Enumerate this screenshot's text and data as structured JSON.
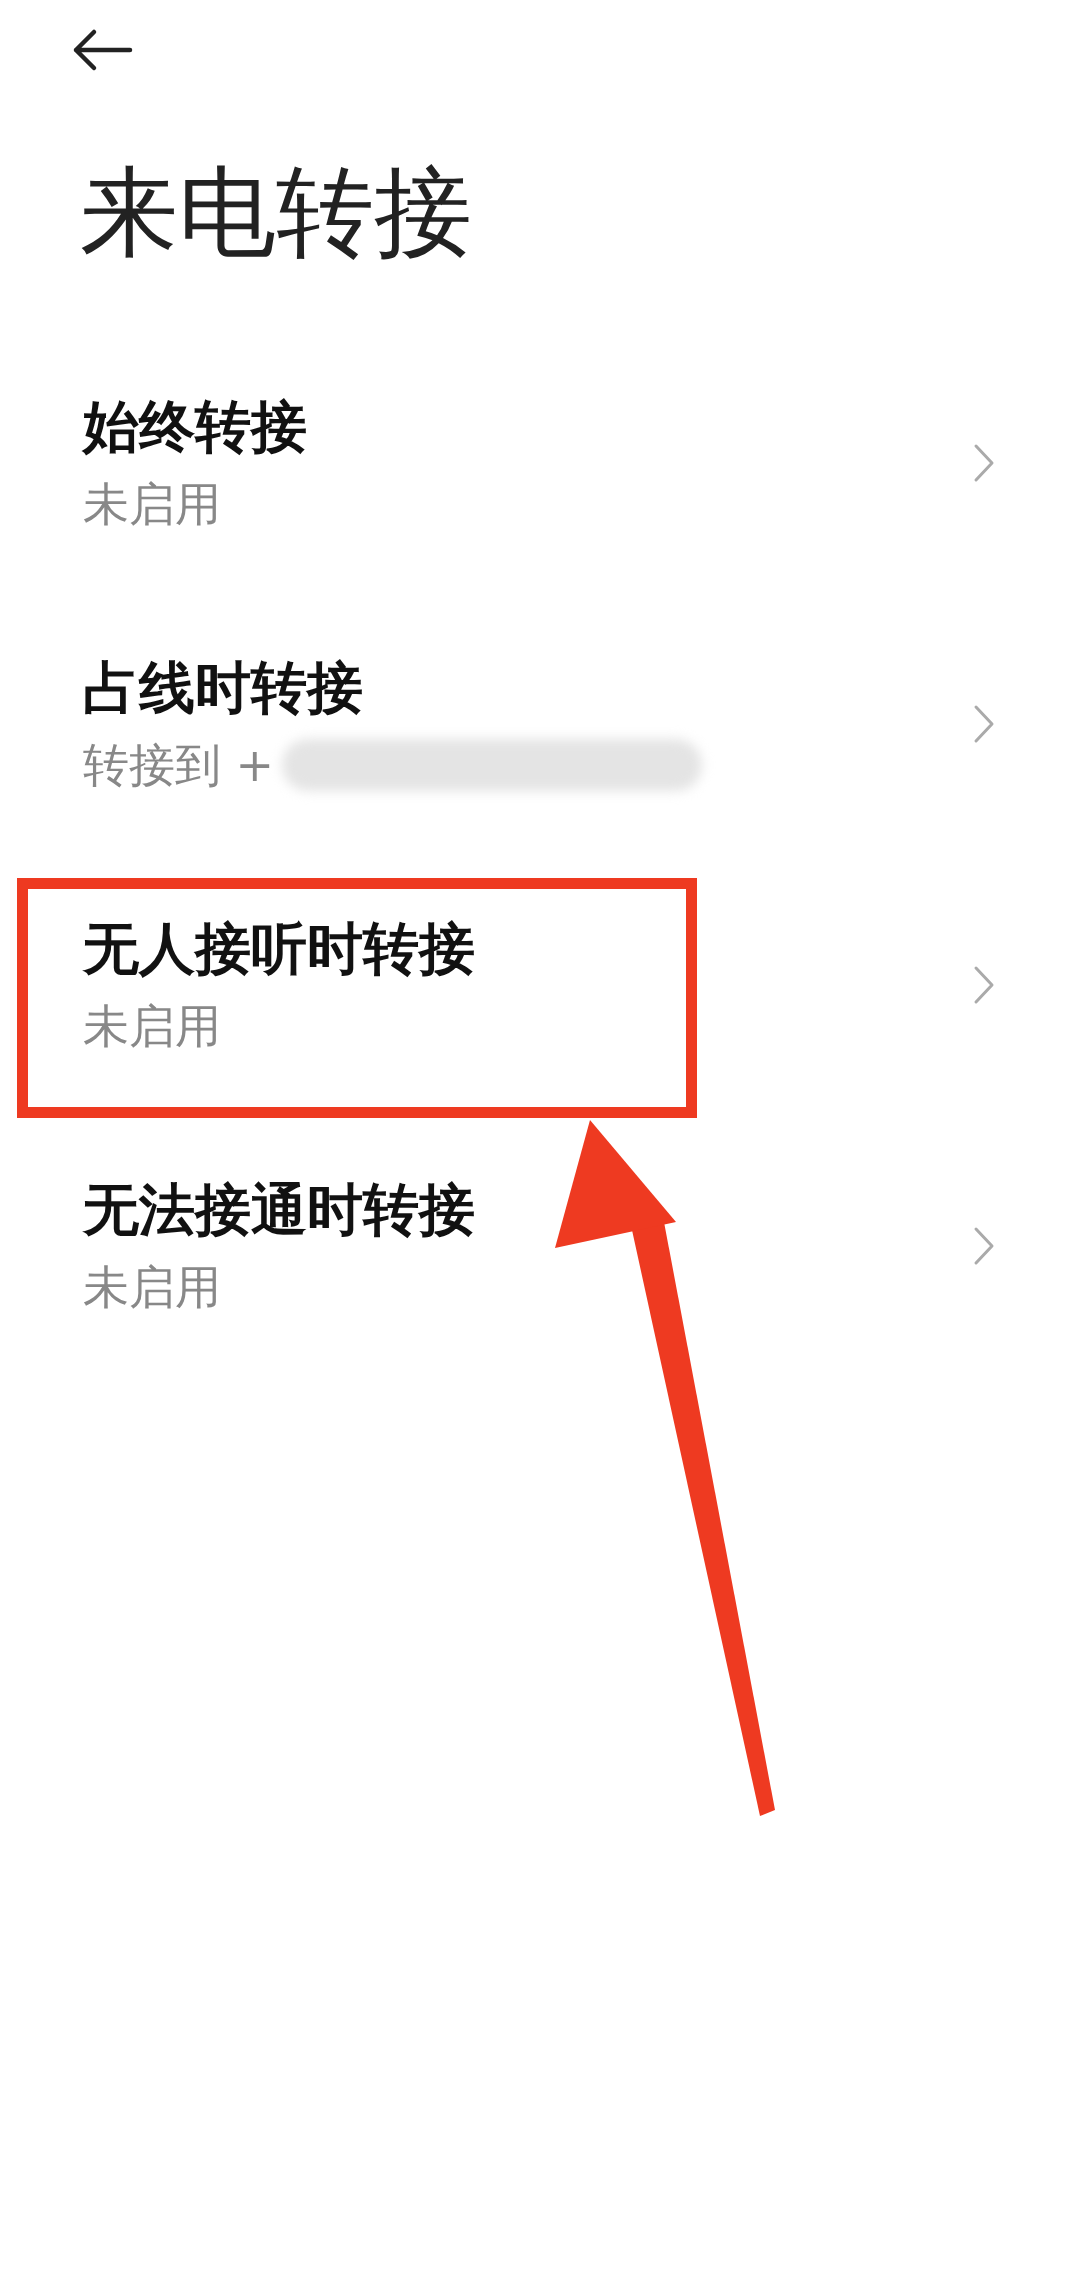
{
  "header": {
    "title": "来电转接"
  },
  "items": [
    {
      "title": "始终转接",
      "subtitle": "未启用",
      "redacted": false,
      "highlighted": false
    },
    {
      "title": "占线时转接",
      "subtitle": "转接到 +",
      "redacted": true,
      "highlighted": false
    },
    {
      "title": "无人接听时转接",
      "subtitle": "未启用",
      "redacted": false,
      "highlighted": true
    },
    {
      "title": "无法接通时转接",
      "subtitle": "未启用",
      "redacted": false,
      "highlighted": false
    }
  ]
}
